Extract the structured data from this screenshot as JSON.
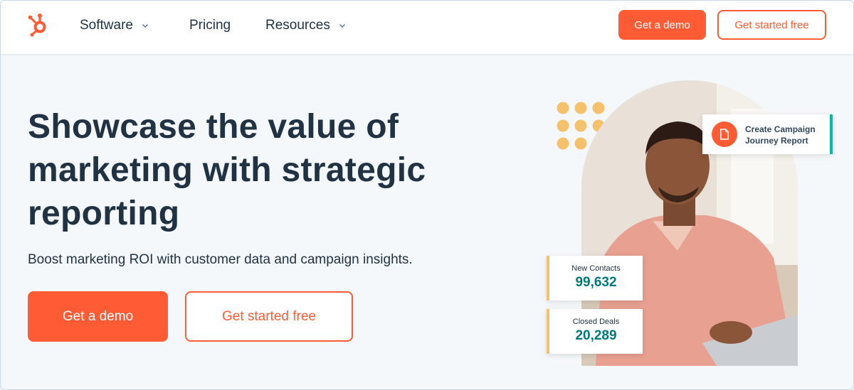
{
  "header": {
    "nav": [
      {
        "label": "Software",
        "has_dropdown": true
      },
      {
        "label": "Pricing",
        "has_dropdown": false
      },
      {
        "label": "Resources",
        "has_dropdown": true
      }
    ],
    "demo_label": "Get a demo",
    "free_label": "Get started free",
    "logo_icon": "sprocket-logo-icon"
  },
  "hero": {
    "headline_lines": [
      "Showcase the value of",
      "marketing with strategic",
      "reporting"
    ],
    "subhead": "Boost marketing ROI with customer data and campaign insights.",
    "cta_demo": "Get a demo",
    "cta_free": "Get started free"
  },
  "illustration": {
    "report_card": {
      "line1": "Create Campaign",
      "line2": "Journey Report",
      "icon": "document-icon"
    },
    "stats": [
      {
        "label": "New Contacts",
        "value": "99,632"
      },
      {
        "label": "Closed Deals",
        "value": "20,289"
      }
    ]
  },
  "colors": {
    "accent": "#ff5c35",
    "text_dark": "#213343",
    "teal": "#00797a",
    "highlight": "#00bda5",
    "dots": "#f5c26b",
    "background": "#f5f8fa"
  }
}
